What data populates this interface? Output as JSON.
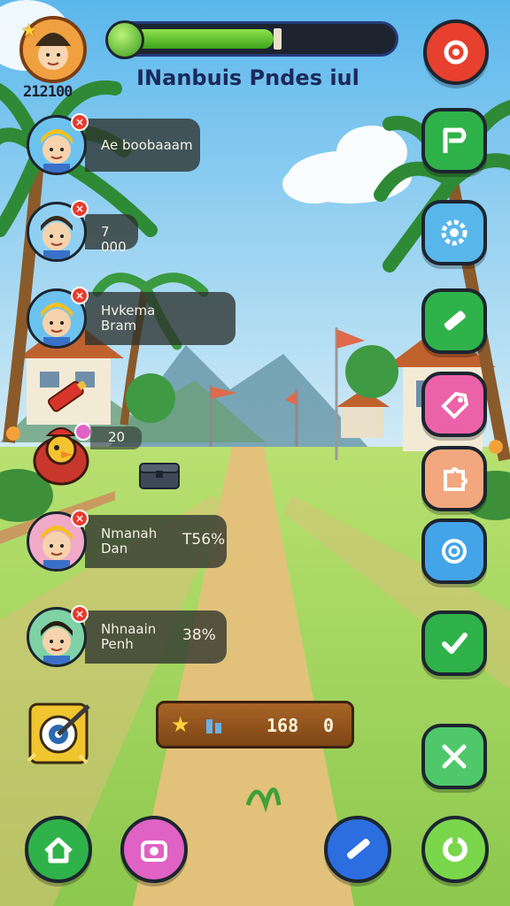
{
  "hud": {
    "player_score": "212100",
    "level_title": "INanbuis Pndes iul",
    "progress": 0.55
  },
  "players": [
    {
      "name": "Ae boobaaam",
      "pct": "",
      "avatar_bg": "#6cc2ee",
      "hair": "#f4c020"
    },
    {
      "name": "7 000",
      "pct": "",
      "avatar_bg": "#8fd0f2",
      "hair": "#3a2a1a"
    },
    {
      "name": "Hvkema\nBram",
      "pct": "",
      "avatar_bg": "#6cc2ee",
      "hair": "#f4c020"
    },
    {
      "name": "Nmanah\nDan",
      "pct": "T56%",
      "avatar_bg": "#f1a9c8",
      "hair": "#f4c020"
    },
    {
      "name": "Nhnaain\nPenh",
      "pct": "38%",
      "avatar_bg": "#7ed2a6",
      "hair": "#2a1a10"
    }
  ],
  "chicken": {
    "value": "20"
  },
  "resources": {
    "value1": "168",
    "value2": "0"
  },
  "right_buttons": [
    {
      "name": "refresh-button",
      "icon": "refresh-icon",
      "color": "#e8402e"
    },
    {
      "name": "flag-button",
      "icon": "flag-icon",
      "color": "#2fb24a"
    },
    {
      "name": "settings-button",
      "icon": "gear-icon",
      "color": "#59b6ea"
    },
    {
      "name": "pencil-button",
      "icon": "pencil-icon",
      "color": "#2fb24a"
    },
    {
      "name": "tag-button",
      "icon": "tag-icon",
      "color": "#ec62a8"
    },
    {
      "name": "puzzle-button",
      "icon": "puzzle-icon",
      "color": "#f3a77e"
    },
    {
      "name": "shield-button",
      "icon": "shield-icon",
      "color": "#44a4e8"
    },
    {
      "name": "check-button",
      "icon": "check-icon",
      "color": "#2fb24a"
    },
    {
      "name": "tools-button",
      "icon": "tools-icon",
      "color": "#4fc86a"
    }
  ],
  "bottom_buttons": [
    {
      "name": "home-button",
      "icon": "home-icon",
      "color": "#2fb24a"
    },
    {
      "name": "camera-button",
      "icon": "camera-icon",
      "color": "#e062c4"
    },
    {
      "name": "edit-button",
      "icon": "pen-icon",
      "color": "#2c6ee0"
    },
    {
      "name": "reload-button",
      "icon": "reload-icon",
      "color": "#7ad64a"
    }
  ],
  "target_icon": "target-icon",
  "colors": {
    "sky_top": "#6cc2ee",
    "sky_bottom": "#cfe9f6",
    "grass": "#a9d96a",
    "path": "#e2c27a"
  }
}
